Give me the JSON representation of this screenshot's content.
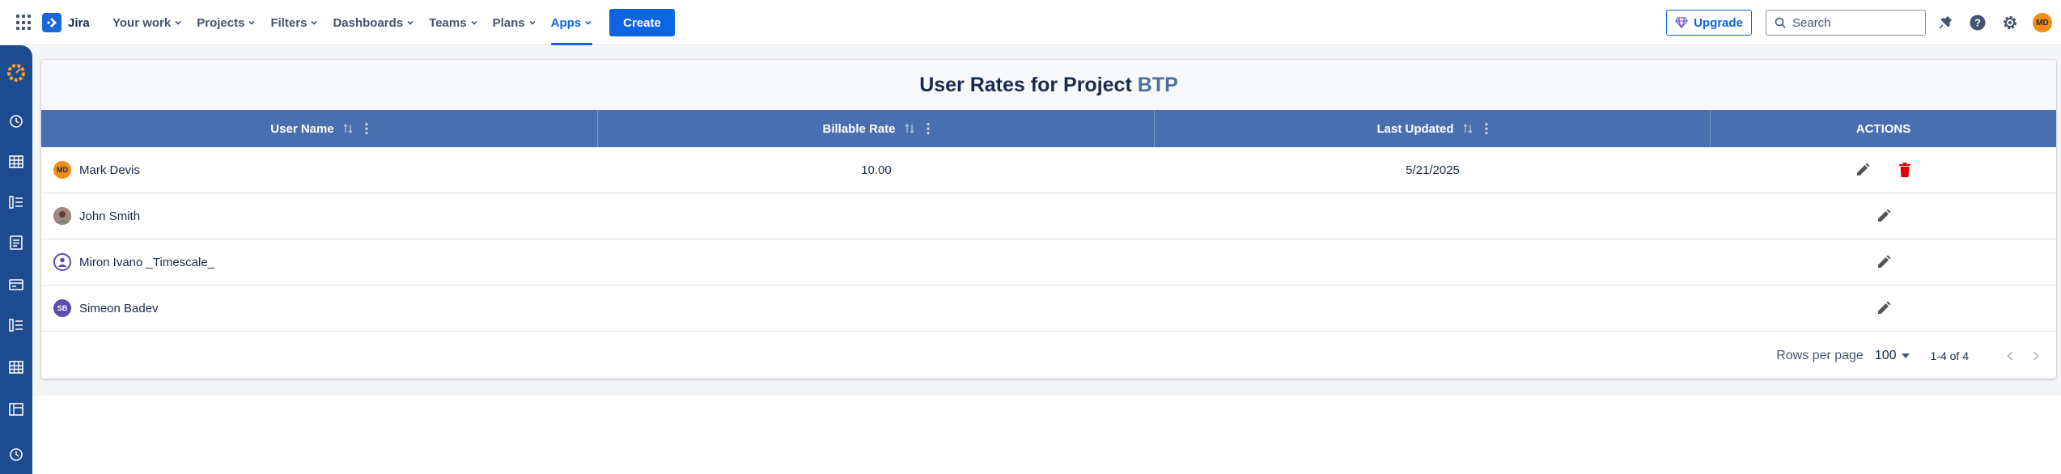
{
  "topnav": {
    "brand": "Jira",
    "items": [
      {
        "label": "Your work"
      },
      {
        "label": "Projects"
      },
      {
        "label": "Filters"
      },
      {
        "label": "Dashboards"
      },
      {
        "label": "Teams"
      },
      {
        "label": "Plans"
      },
      {
        "label": "Apps",
        "active": true
      }
    ],
    "create_label": "Create",
    "upgrade_label": "Upgrade",
    "search_placeholder": "Search",
    "user_initials": "MD",
    "icons": [
      "app-switcher-icon",
      "notifications-icon",
      "help-icon",
      "settings-icon"
    ]
  },
  "sidebar": {
    "icons": [
      "timescale-logo-icon",
      "clock-icon",
      "table-icon",
      "list-icon",
      "document-icon",
      "card-icon",
      "list-icon",
      "table-icon",
      "layout-icon",
      "clock-icon"
    ]
  },
  "page": {
    "title_prefix": "User Rates for Project",
    "project_key": "BTP"
  },
  "table": {
    "columns": [
      {
        "label": "User Name",
        "sortable": true
      },
      {
        "label": "Billable Rate",
        "sortable": true
      },
      {
        "label": "Last Updated",
        "sortable": true
      },
      {
        "label": "ACTIONS",
        "sortable": false
      }
    ],
    "rows": [
      {
        "initials": "MD",
        "name": "Mark Devis",
        "rate": "10.00",
        "updated": "5/21/2025",
        "can_delete": true
      },
      {
        "initials": "",
        "name": "John Smith",
        "rate": "",
        "updated": "",
        "can_delete": false
      },
      {
        "initials": "",
        "name": "Miron Ivano _Timescale_",
        "rate": "",
        "updated": "",
        "can_delete": false
      },
      {
        "initials": "SB",
        "name": "Simeon Badev",
        "rate": "",
        "updated": "",
        "can_delete": false
      }
    ]
  },
  "pagination": {
    "rows_per_page_label": "Rows per page",
    "rows_per_page_value": "100",
    "range_text": "1-4 of 4"
  },
  "colors": {
    "brand_blue": "#0c66e4",
    "header_row": "#4a6fb0",
    "sidebar": "#1d4b8f",
    "delete_red": "#e2000f"
  }
}
